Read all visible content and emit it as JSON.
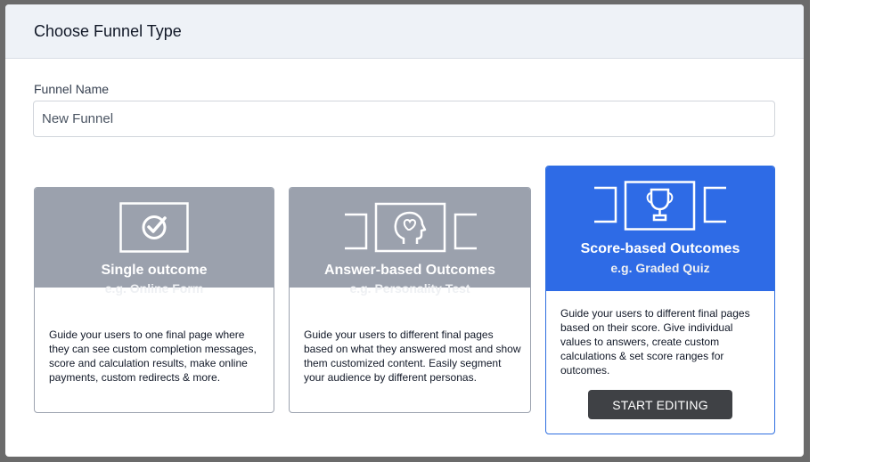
{
  "modal": {
    "title": "Choose Funnel Type",
    "funnel_name_label": "Funnel Name",
    "funnel_name_value": "New Funnel"
  },
  "cards": [
    {
      "title": "Single outcome",
      "subtitle": "e.g. Online Form",
      "description": "Guide your users to one final page where they can see custom completion messages, score and calculation results, make online payments, custom redirects & more.",
      "icon": "checkmark-icon"
    },
    {
      "title": "Answer-based Outcomes",
      "subtitle": "e.g. Personality Test",
      "description": "Guide your users to different final pages based on what they answered most and show them customized content. Easily segment your audience by different personas.",
      "icon": "head-heart-icon"
    },
    {
      "title": "Score-based Outcomes",
      "subtitle": "e.g. Graded Quiz",
      "description": "Guide your users to different final pages based on their score. Give individual values to answers, create custom calculations & set score ranges for outcomes.",
      "icon": "trophy-icon",
      "button_label": "START EDITING",
      "selected": true
    }
  ],
  "colors": {
    "accent": "#2e6be6",
    "card_header": "#9ba1ad",
    "button": "#3f4145"
  }
}
